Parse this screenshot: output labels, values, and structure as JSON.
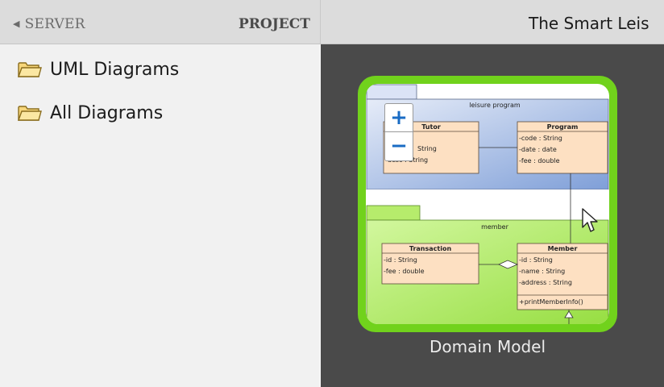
{
  "topbar": {
    "server_label": "SERVER",
    "project_label": "PROJECT",
    "project_title": "The Smart Leis"
  },
  "sidebar": {
    "items": [
      {
        "label": "UML Diagrams",
        "icon": "folder-icon"
      },
      {
        "label": "All Diagrams",
        "icon": "folder-icon"
      }
    ]
  },
  "thumbnail": {
    "caption": "Domain Model",
    "packages": {
      "top": "leisure program",
      "bottom": "member"
    },
    "classes": {
      "tutor": {
        "name": "Tutor",
        "attrs": [
          "ng",
          "String",
          "-desc : String"
        ]
      },
      "program": {
        "name": "Program",
        "attrs": [
          "-code : String",
          "-date : date",
          "-fee : double"
        ]
      },
      "transaction": {
        "name": "Transaction",
        "attrs": [
          "-id : String",
          "-fee : double"
        ]
      },
      "member": {
        "name": "Member",
        "attrs": [
          "-id : String",
          "-name : String",
          "-address : String"
        ],
        "ops": [
          "+printMemberInfo()"
        ]
      }
    }
  },
  "zoom": {
    "in_label": "+",
    "out_label": "−"
  },
  "colors": {
    "accent_green": "#71d21c",
    "zoom_blue": "#1a6cc4",
    "class_fill": "#fde0c2",
    "package_blue": "#b8c9ec",
    "package_green": "#b6ec6c"
  }
}
